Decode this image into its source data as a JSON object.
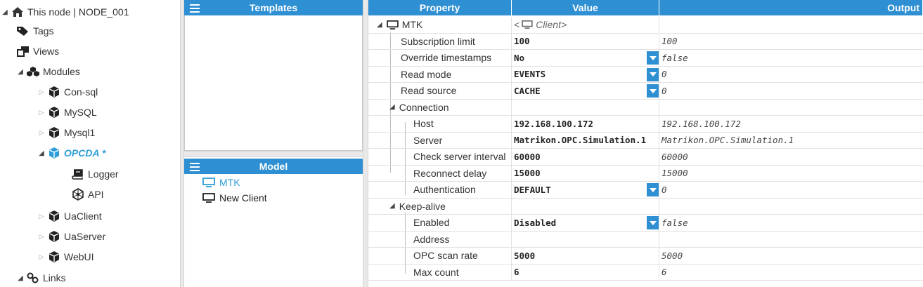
{
  "tree": {
    "root": "This node | NODE_001",
    "tags": "Tags",
    "views": "Views",
    "modules": "Modules",
    "module_items": [
      "Con-sql",
      "MySQL",
      "Mysql1",
      "OPCDA *",
      "UaClient",
      "UaServer",
      "WebUI"
    ],
    "opcda_children": [
      "Logger",
      "API"
    ],
    "links": "Links"
  },
  "templates": {
    "title": "Templates"
  },
  "model": {
    "title": "Model",
    "items": [
      "MTK",
      "New Client"
    ]
  },
  "grid": {
    "headers": {
      "property": "Property",
      "value": "Value",
      "output": "Output"
    },
    "root": {
      "label": "MTK",
      "value": "Client"
    },
    "rows": {
      "subscription_limit": {
        "label": "Subscription limit",
        "value": "100",
        "output": "100"
      },
      "override_timestamps": {
        "label": "Override timestamps",
        "value": "No",
        "output": "false"
      },
      "read_mode": {
        "label": "Read mode",
        "value": "EVENTS",
        "output": "0"
      },
      "read_source": {
        "label": "Read source",
        "value": "CACHE",
        "output": "0"
      },
      "connection": {
        "label": "Connection"
      },
      "host": {
        "label": "Host",
        "value": "192.168.100.172",
        "output": "192.168.100.172"
      },
      "server": {
        "label": "Server",
        "value": "Matrikon.OPC.Simulation.1",
        "output": "Matrikon.OPC.Simulation.1"
      },
      "check_interval": {
        "label": "Check server interval",
        "value": "60000",
        "output": "60000"
      },
      "reconnect_delay": {
        "label": "Reconnect delay",
        "value": "15000",
        "output": "15000"
      },
      "authentication": {
        "label": "Authentication",
        "value": "DEFAULT",
        "output": "0"
      },
      "keep_alive": {
        "label": "Keep-alive"
      },
      "enabled": {
        "label": "Enabled",
        "value": "Disabled",
        "output": "false"
      },
      "address": {
        "label": "Address",
        "value": "",
        "output": ""
      },
      "opc_scan_rate": {
        "label": "OPC scan rate",
        "value": "5000",
        "output": "5000"
      },
      "max_count": {
        "label": "Max count",
        "value": "6",
        "output": "6"
      }
    }
  },
  "colors": {
    "accent": "#2f8fd3",
    "active_text": "#2e9ed8"
  }
}
